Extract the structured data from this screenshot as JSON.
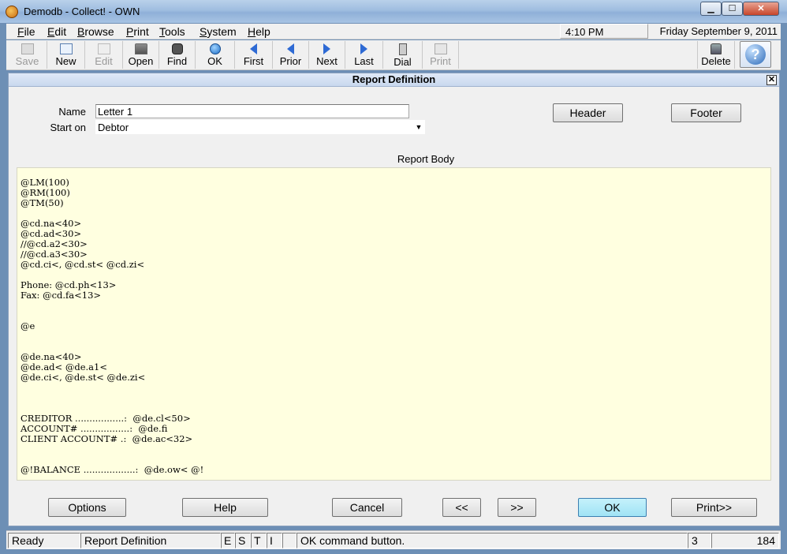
{
  "window": {
    "title": "Demodb - Collect! - OWN",
    "min_glyph": "▁",
    "max_glyph": "☐",
    "close_glyph": "✕"
  },
  "menu": [
    {
      "label_u": "F",
      "label_rest": "ile"
    },
    {
      "label_u": "E",
      "label_rest": "dit"
    },
    {
      "label_u": "B",
      "label_rest": "rowse"
    },
    {
      "label_u": "P",
      "label_rest": "rint"
    },
    {
      "label_u": "T",
      "label_rest": "ools"
    },
    {
      "label_u": "S",
      "label_rest": "ystem"
    },
    {
      "label_u": "H",
      "label_rest": "elp"
    }
  ],
  "clock": "4:10 PM",
  "date": "Friday  September 9, 2011",
  "toolbar": {
    "save": "Save",
    "new": "New",
    "edit": "Edit",
    "open": "Open",
    "find": "Find",
    "ok": "OK",
    "first": "First",
    "prior": "Prior",
    "next": "Next",
    "last": "Last",
    "dial": "Dial",
    "print": "Print",
    "delete": "Delete",
    "help_glyph": "?"
  },
  "dialog": {
    "title": "Report Definition",
    "close_glyph": "✕",
    "name_label": "Name",
    "name_value": "Letter 1",
    "start_label": "Start on",
    "start_value": "Debtor",
    "combo_glyph": "▼",
    "header_btn": "Header",
    "footer_btn": "Footer",
    "body_title": "Report Body",
    "body_text": "@LM(100)\n@RM(100)\n@TM(50)\n\n@cd.na<40>\n@cd.ad<30>\n//@cd.a2<30>\n//@cd.a3<30>\n@cd.ci<, @cd.st< @cd.zi<\n\nPhone: @cd.ph<13>\nFax: @cd.fa<13>\n\n\n@e\n\n\n@de.na<40>\n@de.ad< @de.a1<\n@de.ci<, @de.st< @de.zi<\n\n\n\nCREDITOR .................:  @de.cl<50>\nACCOUNT# .................:  @de.fi\nCLIENT ACCOUNT# .:  @de.ac<32>\n\n\n@!BALANCE ..................:  @de.ow< @!",
    "buttons": {
      "options": "Options",
      "help": "Help",
      "cancel": "Cancel",
      "prev": "<<",
      "next": ">>",
      "ok": "OK",
      "print": "Print>>"
    }
  },
  "status": {
    "ready": "Ready",
    "context": "Report Definition",
    "e": "E",
    "s": "S",
    "t": "T",
    "i": "I",
    "message": "OK command button.",
    "num1": "3",
    "num2": "184"
  }
}
